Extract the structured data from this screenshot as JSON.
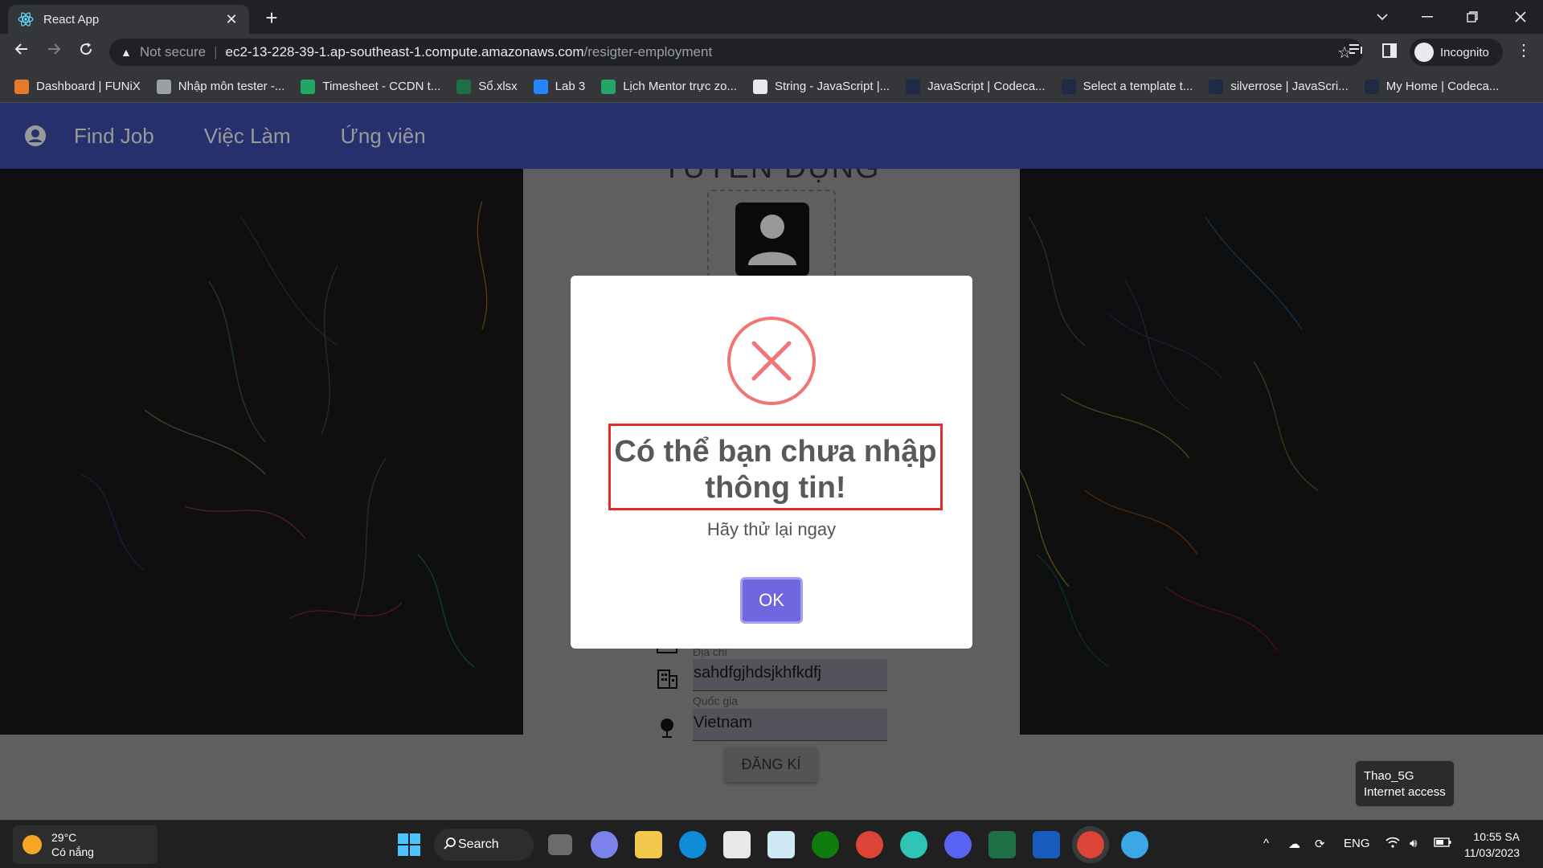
{
  "browser": {
    "tab_title": "React App",
    "close_symbol": "✕",
    "new_tab_symbol": "+",
    "not_secure": "Not secure",
    "url_host": "ec2-13-228-39-1.ap-southeast-1.compute.amazonaws.com",
    "url_path": "/resigter-employment",
    "profile_label": "Incognito",
    "bookmarks": [
      {
        "label": "Dashboard | FUNiX",
        "color": "#e37b2b"
      },
      {
        "label": "Nhập môn tester -...",
        "color": "#9aa0a6"
      },
      {
        "label": "Timesheet - CCDN t...",
        "color": "#23a566"
      },
      {
        "label": "Sổ.xlsx",
        "color": "#1d7044"
      },
      {
        "label": "Lab 3",
        "color": "#2684ff"
      },
      {
        "label": "Lịch Mentor trực zo...",
        "color": "#23a566"
      },
      {
        "label": "String - JavaScript |...",
        "color": "#e8eaed"
      },
      {
        "label": "JavaScript | Codeca...",
        "color": "#1f2a44"
      },
      {
        "label": "Select a template t...",
        "color": "#1f2a44"
      },
      {
        "label": "silverrose | JavaScri...",
        "color": "#1f2a44"
      },
      {
        "label": "My Home | Codeca...",
        "color": "#1f2a44"
      }
    ]
  },
  "app": {
    "nav": [
      "Find Job",
      "Việc Làm",
      "Ứng viên"
    ],
    "form_heading": "TUYỂN DỤNG",
    "fields": [
      {
        "label": "Địa chỉ",
        "value": "sahdfgjhdsjkhfkdfj",
        "icon": "building-icon"
      },
      {
        "label": "Quốc gia",
        "value": "Vietnam",
        "icon": "pin-icon"
      }
    ],
    "submit_label": "ĐĂNG KÍ",
    "accent": "#3f51b5"
  },
  "modal": {
    "icon": "error-x-icon",
    "title": "Có thể bạn chưa nhập thông tin!",
    "text": "Hãy thử lại ngay",
    "confirm_label": "OK",
    "confirm_color": "#7066e0",
    "highlight_color": "#e32c2c"
  },
  "wifi_tooltip": {
    "network": "Thao_5G",
    "status": "Internet access"
  },
  "taskbar": {
    "weather_temp": "29°C",
    "weather_desc": "Có nắng",
    "search_label": "Search",
    "language": "ENG",
    "time": "10:55 SA",
    "date": "11/03/2023"
  }
}
